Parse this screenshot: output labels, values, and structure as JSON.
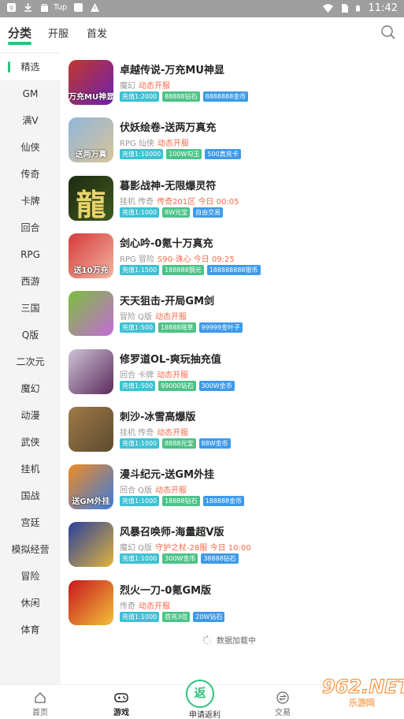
{
  "status_bar": {
    "time": "11:42",
    "extra_label": "Tup",
    "icons": [
      "app-badge-icon",
      "download-icon",
      "bag-icon",
      "square-icon",
      "warning-icon",
      "wifi-icon",
      "sim-icon",
      "battery-icon"
    ]
  },
  "top_tabs": [
    {
      "label": "分类",
      "active": true
    },
    {
      "label": "开服",
      "active": false
    },
    {
      "label": "首发",
      "active": false
    }
  ],
  "sidebar": {
    "items": [
      {
        "label": "精选",
        "active": true
      },
      {
        "label": "GM"
      },
      {
        "label": "满V"
      },
      {
        "label": "仙侠"
      },
      {
        "label": "传奇"
      },
      {
        "label": "卡牌"
      },
      {
        "label": "回合"
      },
      {
        "label": "RPG"
      },
      {
        "label": "西游"
      },
      {
        "label": "三国"
      },
      {
        "label": "Q版"
      },
      {
        "label": "二次元"
      },
      {
        "label": "魔幻"
      },
      {
        "label": "动漫"
      },
      {
        "label": "武侠"
      },
      {
        "label": "挂机"
      },
      {
        "label": "国战"
      },
      {
        "label": "宫廷"
      },
      {
        "label": "模拟经营"
      },
      {
        "label": "冒险"
      },
      {
        "label": "休闲"
      },
      {
        "label": "体育"
      }
    ]
  },
  "games": [
    {
      "title": "卓越传说-万充MU神显",
      "category": "魔幻",
      "status": "动态开服",
      "tags": [
        {
          "text": "充值1:2000",
          "color": "#3fc1d3"
        },
        {
          "text": "88888钻石",
          "color": "#4cc387"
        },
        {
          "text": "8888888金币",
          "color": "#3e9ae8"
        }
      ],
      "thumb": [
        "#c0392b",
        "#6c1fb3"
      ],
      "icon_text": "万充MU神显"
    },
    {
      "title": "伏妖绘卷-送两万真充",
      "category": "RPG 仙侠",
      "status": "动态开服",
      "tags": [
        {
          "text": "充值1:10000",
          "color": "#3fc1d3"
        },
        {
          "text": "100W勾玉",
          "color": "#4cc387"
        },
        {
          "text": "500真充卡",
          "color": "#3e9ae8"
        }
      ],
      "thumb": [
        "#8fb6d9",
        "#d9c49a"
      ],
      "icon_text": "送两万真"
    },
    {
      "title": "暮影战神-无限爆灵符",
      "category": "挂机 传奇",
      "status": "传奇201区 今日 00:05",
      "tags": [
        {
          "text": "充值1:1000",
          "color": "#3fc1d3"
        },
        {
          "text": "8W元宝",
          "color": "#4cc387"
        },
        {
          "text": "自由交易",
          "color": "#3e9ae8"
        }
      ],
      "thumb": [
        "#1e2a12",
        "#3f5a1f"
      ],
      "icon_text": "龍"
    },
    {
      "title": "剑心吟-0氪十万真充",
      "category": "RPG 冒险",
      "status": "S90-诛心 今日 09:25",
      "tags": [
        {
          "text": "充值1:1500",
          "color": "#3fc1d3"
        },
        {
          "text": "188888钢元",
          "color": "#4cc387"
        },
        {
          "text": "188888888银币",
          "color": "#3e9ae8"
        }
      ],
      "thumb": [
        "#d63a3a",
        "#f2b5a2"
      ],
      "icon_text": "送10万充"
    },
    {
      "title": "天天狙击-开局GM剑",
      "category": "冒险 Q版",
      "status": "动态开服",
      "tags": [
        {
          "text": "充值1:500",
          "color": "#3fc1d3"
        },
        {
          "text": "18888瑶草",
          "color": "#4cc387"
        },
        {
          "text": "99999金叶子",
          "color": "#3e9ae8"
        }
      ],
      "thumb": [
        "#7bbf3a",
        "#c46ad8"
      ],
      "icon_text": ""
    },
    {
      "title": "修罗道OL-爽玩抽充值",
      "category": "回合 卡牌",
      "status": "动态开服",
      "tags": [
        {
          "text": "充值1:500",
          "color": "#3fc1d3"
        },
        {
          "text": "99000钻石",
          "color": "#4cc387"
        },
        {
          "text": "300W金币",
          "color": "#3e9ae8"
        }
      ],
      "thumb": [
        "#cfc3d6",
        "#5b2a5c"
      ],
      "icon_text": ""
    },
    {
      "title": "刺沙-冰雪高爆版",
      "category": "挂机 传奇",
      "status": "动态开服",
      "tags": [
        {
          "text": "充值1:1000",
          "color": "#3fc1d3"
        },
        {
          "text": "8888元宝",
          "color": "#4cc387"
        },
        {
          "text": "88W金币",
          "color": "#3e9ae8"
        }
      ],
      "thumb": [
        "#a07a48",
        "#5c4a2e"
      ],
      "icon_text": ""
    },
    {
      "title": "漫斗纪元-送GM外挂",
      "category": "回合 Q版",
      "status": "动态开服",
      "tags": [
        {
          "text": "充值1:1000",
          "color": "#3fc1d3"
        },
        {
          "text": "18888钻石",
          "color": "#4cc387"
        },
        {
          "text": "188888金币",
          "color": "#3e9ae8"
        }
      ],
      "thumb": [
        "#f08a24",
        "#3b7de0"
      ],
      "icon_text": "送GM外挂"
    },
    {
      "title": "风暴召唤师-海量超V版",
      "category": "魔幻 Q版",
      "status": "守护之杖-28服 今日 10:00",
      "tags": [
        {
          "text": "充值1:1000",
          "color": "#3fc1d3"
        },
        {
          "text": "300W金币",
          "color": "#4cc387"
        },
        {
          "text": "38888钻石",
          "color": "#3e9ae8"
        }
      ],
      "thumb": [
        "#2a3f9e",
        "#e0b43a"
      ],
      "icon_text": ""
    },
    {
      "title": "烈火一刀-0氪GM版",
      "category": "传奇",
      "status": "动态开服",
      "tags": [
        {
          "text": "充值1:1000",
          "color": "#3fc1d3"
        },
        {
          "text": "首充3倍",
          "color": "#4cc387"
        },
        {
          "text": "20W钻石",
          "color": "#3e9ae8"
        }
      ],
      "thumb": [
        "#c8161d",
        "#f2c13a"
      ],
      "icon_text": ""
    }
  ],
  "loading_text": "数据加载中",
  "bottom_nav": [
    {
      "label": "首页",
      "icon": "home-icon",
      "active": false
    },
    {
      "label": "游戏",
      "icon": "gamepad-icon",
      "active": true
    },
    {
      "label": "申请返利",
      "icon": "rebate-icon",
      "active": false,
      "badge": "返"
    },
    {
      "label": "交易",
      "icon": "exchange-icon",
      "active": false
    }
  ],
  "watermark": {
    "number": "962.NET",
    "sub": "乐游网"
  },
  "colors": {
    "accent": "#2dc27d",
    "status": "#f26b4a"
  }
}
